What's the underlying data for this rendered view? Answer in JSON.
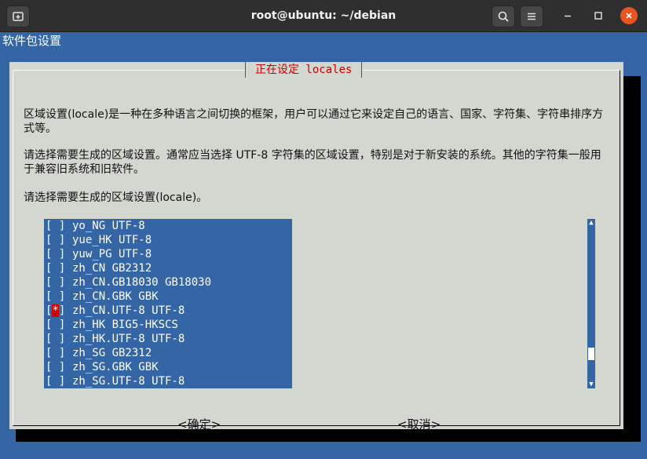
{
  "window": {
    "title": "root@ubuntu: ~/debian",
    "icons": [
      "new-tab-icon",
      "search-icon",
      "hamburger-menu-icon",
      "minimize-icon",
      "maximize-icon",
      "close-icon"
    ]
  },
  "terminal": {
    "backtitle": "软件包设置"
  },
  "dialog": {
    "title": "正在设定 locales",
    "message1": "区域设置(locale)是一种在多种语言之间切换的框架，用户可以通过它来设定自己的语言、国家、字符集、字符串排序方式等。",
    "message2": "请选择需要生成的区域设置。通常应当选择 UTF-8 字符集的区域设置，特别是对于新安装的系统。其他的字符集一般用于兼容旧系统和旧软件。",
    "message3": "请选择需要生成的区域设置(locale)。",
    "items": [
      {
        "check": "[ ]",
        "label": "yo_NG UTF-8",
        "selected": false
      },
      {
        "check": "[ ]",
        "label": "yue_HK UTF-8",
        "selected": false
      },
      {
        "check": "[ ]",
        "label": "yuw_PG UTF-8",
        "selected": false
      },
      {
        "check": "[ ]",
        "label": "zh_CN GB2312",
        "selected": false
      },
      {
        "check": "[ ]",
        "label": "zh_CN.GB18030 GB18030",
        "selected": false
      },
      {
        "check": "[ ]",
        "label": "zh_CN.GBK GBK",
        "selected": false
      },
      {
        "check": "[*]",
        "label": "zh_CN.UTF-8 UTF-8",
        "selected": true
      },
      {
        "check": "[ ]",
        "label": "zh_HK BIG5-HKSCS",
        "selected": false
      },
      {
        "check": "[ ]",
        "label": "zh_HK.UTF-8 UTF-8",
        "selected": false
      },
      {
        "check": "[ ]",
        "label": "zh_SG GB2312",
        "selected": false
      },
      {
        "check": "[ ]",
        "label": "zh_SG.GBK GBK",
        "selected": false
      },
      {
        "check": "[ ]",
        "label": "zh_SG.UTF-8 UTF-8",
        "selected": false
      }
    ],
    "ok_label": "<确定>",
    "cancel_label": "<取消>"
  },
  "colors": {
    "terminal_bg": "#3465a4",
    "dialog_bg": "#d3d7cf",
    "title_red": "#cc0000",
    "close_orange": "#e95420"
  }
}
